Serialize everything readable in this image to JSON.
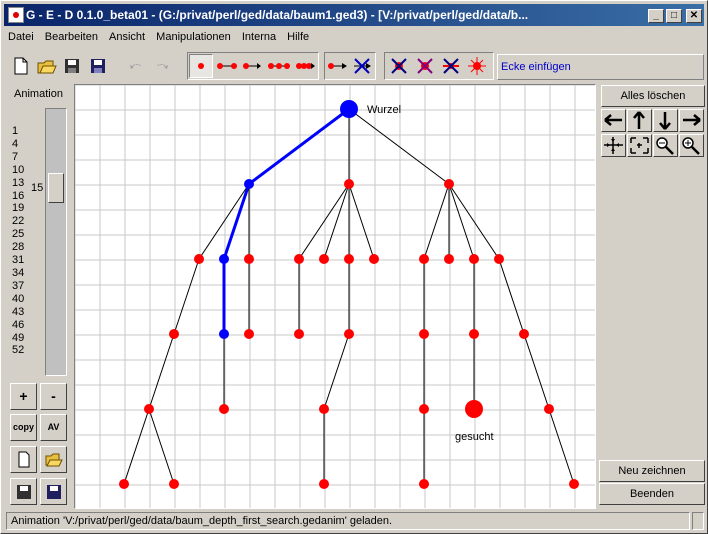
{
  "window": {
    "title": "G - E - D   0.1.0_beta01   -   (G:/privat/perl/ged/data/baum1.ged3)   -   [V:/privat/perl/ged/data/b...",
    "minimize": "_",
    "maximize": "□",
    "close": "✕"
  },
  "menu": [
    "Datei",
    "Bearbeiten",
    "Ansicht",
    "Manipulationen",
    "Interna",
    "Hilfe"
  ],
  "toolbar": {
    "hint": "Ecke einfügen",
    "icons": [
      "new-file-icon",
      "open-folder-icon",
      "save-icon",
      "save-as-icon",
      "undo-icon",
      "redo-icon",
      "add-vertex-icon",
      "add-edge-icon",
      "add-path-icon",
      "add-chain-icon",
      "add-multi-icon",
      "directed-edge-icon",
      "delete-edge-icon",
      "delete-vertex-icon",
      "delete-selection-icon",
      "delete-all-icon",
      "move-vertex-icon"
    ]
  },
  "animation": {
    "label": "Animation",
    "ticks": [
      "1",
      "4",
      "7",
      "10",
      "13",
      "16",
      "19",
      "22",
      "25",
      "28",
      "31",
      "34",
      "37",
      "40",
      "43",
      "46",
      "49",
      "52"
    ],
    "current": "15",
    "current_fraction": 0.27,
    "buttons": {
      "plus": "+",
      "minus": "-",
      "copy": "copy",
      "av": "AV"
    }
  },
  "right": {
    "clear_all": "Alles löschen",
    "redraw": "Neu zeichnen",
    "quit": "Beenden"
  },
  "graph": {
    "colors": {
      "visited": "#0000ff",
      "unvisited": "#ff0000",
      "edge": "#000000",
      "grid": "#c8c8c8"
    },
    "labels": {
      "root": "Wurzel",
      "target": "gesucht"
    }
  },
  "status": {
    "message": "Animation 'V:/privat/perl/ged/data/baum_depth_first_search.gedanim' geladen."
  }
}
